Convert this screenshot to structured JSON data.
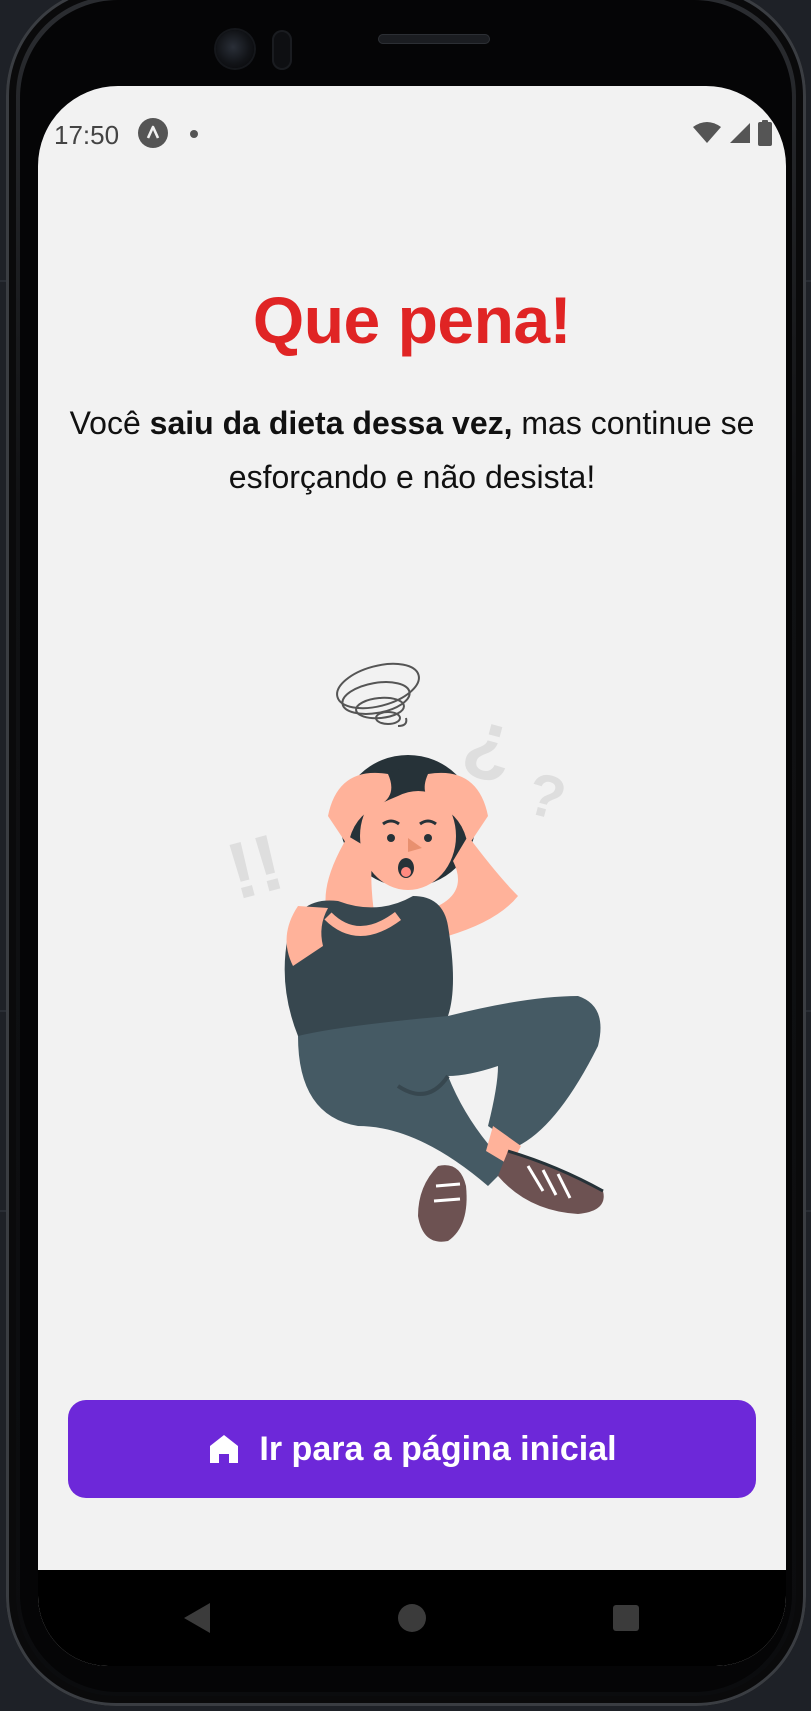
{
  "status_bar": {
    "time": "17:50",
    "app_icon": "a-letter-icon",
    "notification_icon": "dot-icon",
    "right_icons": [
      "wifi-icon",
      "signal-icon",
      "battery-icon"
    ]
  },
  "result": {
    "title": "Que pena!",
    "message_prefix": "Você ",
    "message_bold": "saiu da dieta dessa vez,",
    "message_suffix": " mas continue se esforçando e não desista!",
    "illustration": "confused-person-illustration"
  },
  "actions": {
    "home_button_label": "Ir para a página inicial",
    "home_button_icon": "home-icon"
  },
  "nav_bar": {
    "items": [
      "back-icon",
      "home-circle-icon",
      "recents-icon"
    ]
  },
  "colors": {
    "title": "#e02424",
    "button": "#6d28d9",
    "background": "#f2f2f2"
  }
}
